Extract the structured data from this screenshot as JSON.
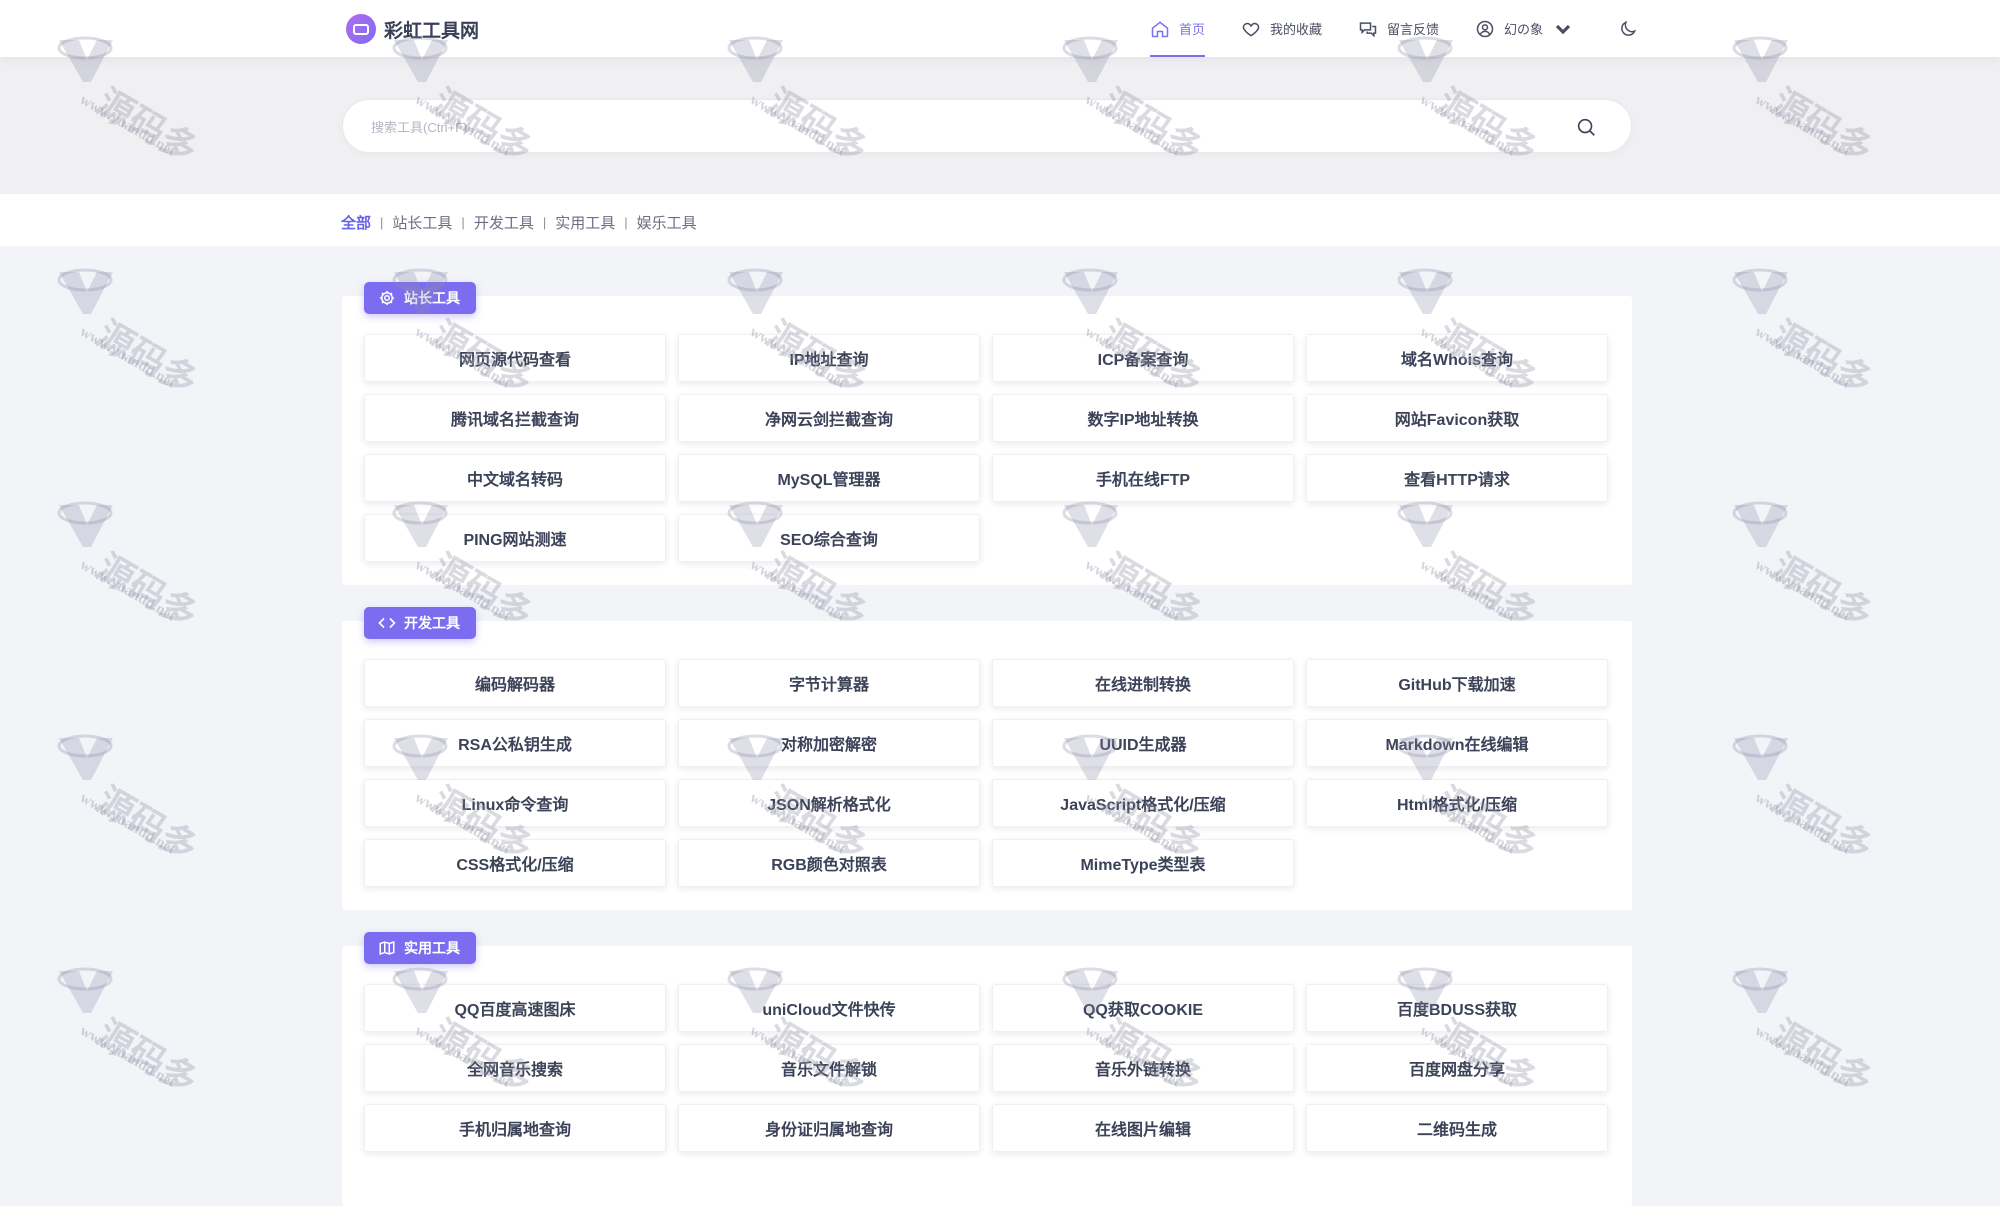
{
  "site": {
    "name": "彩虹工具网"
  },
  "nav": [
    {
      "label": "首页",
      "icon": "home-icon",
      "active": true
    },
    {
      "label": "我的收藏",
      "icon": "heart-icon",
      "active": false
    },
    {
      "label": "留言反馈",
      "icon": "chat-icon",
      "active": false
    },
    {
      "label": "幻の象",
      "icon": "user-icon",
      "active": false
    }
  ],
  "search": {
    "placeholder": "搜索工具(Ctrl+F)"
  },
  "filters": [
    {
      "label": "全部",
      "active": true
    },
    {
      "label": "站长工具",
      "active": false
    },
    {
      "label": "开发工具",
      "active": false
    },
    {
      "label": "实用工具",
      "active": false
    },
    {
      "label": "娱乐工具",
      "active": false
    }
  ],
  "sections": [
    {
      "title": "站长工具",
      "icon": "gear-icon",
      "tools": [
        "网页源代码查看",
        "IP地址查询",
        "ICP备案查询",
        "域名Whois查询",
        "腾讯域名拦截查询",
        "净网云剑拦截查询",
        "数字IP地址转换",
        "网站Favicon获取",
        "中文域名转码",
        "MySQL管理器",
        "手机在线FTP",
        "查看HTTP请求",
        "PING网站测速",
        "SEO综合查询"
      ]
    },
    {
      "title": "开发工具",
      "icon": "code-icon",
      "tools": [
        "编码解码器",
        "字节计算器",
        "在线进制转换",
        "GitHub下载加速",
        "RSA公私钥生成",
        "对称加密解密",
        "UUID生成器",
        "Markdown在线编辑",
        "Linux命令查询",
        "JSON解析格式化",
        "JavaScript格式化/压缩",
        "Html格式化/压缩",
        "CSS格式化/压缩",
        "RGB颜色对照表",
        "MimeType类型表"
      ]
    },
    {
      "title": "实用工具",
      "icon": "map-icon",
      "tools": [
        "QQ百度高速图床",
        "uniCloud文件快传",
        "QQ获取COOKIE",
        "百度BDUSS获取",
        "全网音乐搜索",
        "音乐文件解锁",
        "音乐外链转换",
        "百度网盘分享",
        "手机归属地查询",
        "身份证归属地查询",
        "在线图片编辑",
        "二维码生成"
      ]
    }
  ],
  "watermark": {
    "text": "源码多",
    "url": "www.yuandd.net"
  },
  "colors": {
    "accent": "#7c6df0",
    "text": "#3c4257"
  }
}
